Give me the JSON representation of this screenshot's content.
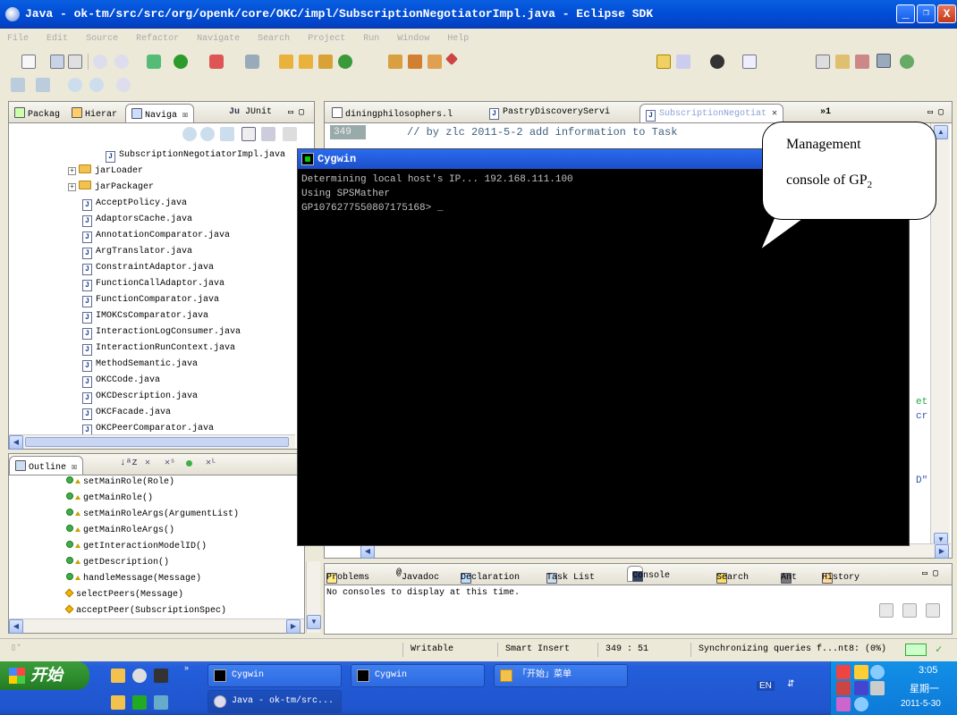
{
  "window": {
    "title": "Java - ok-tm/src/src/org/openk/core/OKC/impl/SubscriptionNegotiatorImpl.java - Eclipse SDK",
    "minimize": "_",
    "maximize": "❐",
    "close": "X"
  },
  "menu": [
    "File",
    "Edit",
    "Source",
    "Refactor",
    "Navigate",
    "Search",
    "Project",
    "Run",
    "Window",
    "Help"
  ],
  "left_tabs": {
    "package": "Packag",
    "hierarchy": "Hierar",
    "navigator": "Naviga",
    "junit": "JUnit"
  },
  "tree": {
    "items": [
      {
        "label": "SubscriptionNegotiatorImpl.java",
        "kind": "file"
      },
      {
        "label": "jarLoader",
        "kind": "folder"
      },
      {
        "label": "jarPackager",
        "kind": "folder"
      },
      {
        "label": "AcceptPolicy.java",
        "kind": "file"
      },
      {
        "label": "AdaptorsCache.java",
        "kind": "file"
      },
      {
        "label": "AnnotationComparator.java",
        "kind": "file"
      },
      {
        "label": "ArgTranslator.java",
        "kind": "file"
      },
      {
        "label": "ConstraintAdaptor.java",
        "kind": "file"
      },
      {
        "label": "FunctionCallAdaptor.java",
        "kind": "file"
      },
      {
        "label": "FunctionComparator.java",
        "kind": "file"
      },
      {
        "label": "IMOKCsComparator.java",
        "kind": "file"
      },
      {
        "label": "InteractionLogConsumer.java",
        "kind": "file"
      },
      {
        "label": "InteractionRunContext.java",
        "kind": "file"
      },
      {
        "label": "MethodSemantic.java",
        "kind": "file"
      },
      {
        "label": "OKCCode.java",
        "kind": "file"
      },
      {
        "label": "OKCDescription.java",
        "kind": "file"
      },
      {
        "label": "OKCFacade.java",
        "kind": "file"
      },
      {
        "label": "OKCPeerComparator.java",
        "kind": "file"
      }
    ]
  },
  "outline": {
    "tab": "Outline",
    "items": [
      "setMainRole(Role)",
      "getMainRole()",
      "setMainRoleArgs(ArgumentList)",
      "getMainRoleArgs()",
      "getInteractionModelID()",
      "getDescription()",
      "handleMessage(Message)",
      "selectPeers(Message)",
      "acceptPeer(SubscriptionSpec)"
    ]
  },
  "editor": {
    "tabs": [
      "diningphilosophers.l",
      "PastryDiscoveryServi",
      "SubscriptionNegotiat"
    ],
    "overflow": "»1",
    "line_no": "349",
    "line_text": "// by zlc 2011-5-2 add information to Task",
    "right_frag_1": "et",
    "right_frag_2": "cr",
    "right_frag_3": "D\""
  },
  "cygwin": {
    "title": "Cygwin",
    "lines": [
      "Determining local host's IP... 192.168.111.100",
      "Using SPSMather",
      "GP10762775508071751​68> _"
    ]
  },
  "callout": {
    "line1": "Management",
    "line2": "console of GP",
    "subscript": "2"
  },
  "bottom_panel": {
    "tabs": [
      "Problems",
      "Javadoc",
      "Declaration",
      "Task List",
      "Console",
      "Search",
      "Ant",
      "History"
    ],
    "message": "No consoles to display at this time."
  },
  "status": {
    "writable": "Writable",
    "insert": "Smart Insert",
    "position": "349 : 51",
    "job": "Synchronizing queries f...nt8: (0%)"
  },
  "taskbar": {
    "start": "开始",
    "buttons": [
      "Cygwin",
      "Cygwin",
      "「开始」菜单",
      "Java - ok-tm/src..."
    ],
    "ime": "EN",
    "time": "3:05",
    "weekday": "星期一",
    "date": "2011-5-30"
  }
}
